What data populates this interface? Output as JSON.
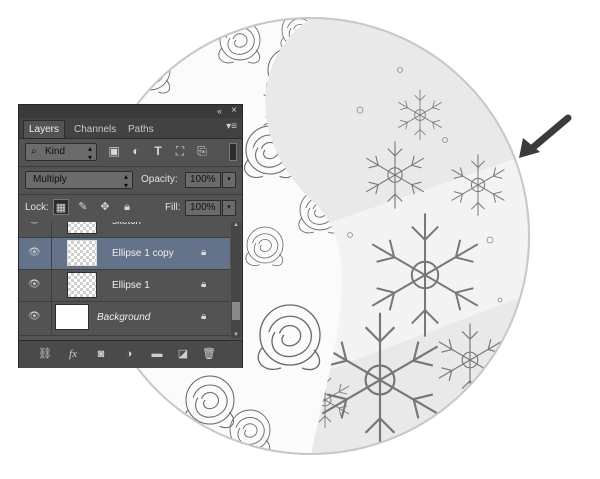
{
  "panel": {
    "double_arrow": "«",
    "close": "×",
    "tabs": [
      {
        "label": "Layers"
      },
      {
        "label": "Channels"
      },
      {
        "label": "Paths"
      }
    ],
    "menu_icon": "menu-icon",
    "filter": {
      "kind_label": "Kind",
      "search_icon": "⌕"
    },
    "blend_mode": "Multiply",
    "opacity_label": "Opacity:",
    "opacity_value": "100%",
    "lock_label": "Lock:",
    "fill_label": "Fill:",
    "fill_value": "100%",
    "layers": [
      {
        "name": "sketch",
        "visible": true,
        "selected": false
      },
      {
        "name": "Ellipse 1 copy",
        "visible": true,
        "selected": true
      },
      {
        "name": "Ellipse 1",
        "visible": true,
        "selected": false
      },
      {
        "name": "Background",
        "visible": true,
        "selected": false
      }
    ],
    "footer_fx": "fx"
  },
  "colors": {
    "panel_bg": "#535353",
    "selected_layer": "#64728a",
    "arrow": "#3b3b3b"
  }
}
